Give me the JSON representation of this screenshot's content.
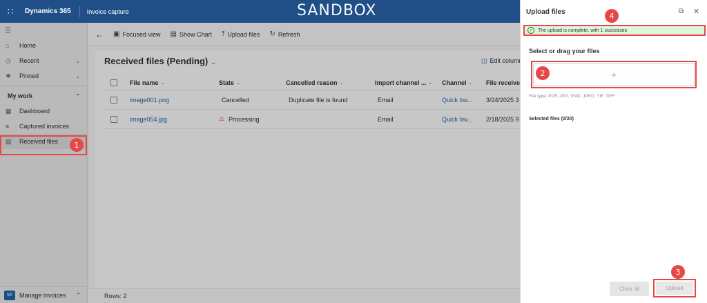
{
  "topbar": {
    "app_name": "Dynamics 365",
    "area_name": "Invoice capture",
    "environment_label": "SANDBOX"
  },
  "nav": {
    "items": [
      {
        "label": "Home",
        "icon": "home-icon"
      },
      {
        "label": "Recent",
        "icon": "clock-icon"
      },
      {
        "label": "Pinned",
        "icon": "pin-icon"
      }
    ],
    "section_title": "My work",
    "section_items": [
      {
        "label": "Dashboard",
        "icon": "dashboard-icon"
      },
      {
        "label": "Captured invoices",
        "icon": "list-icon"
      },
      {
        "label": "Received files",
        "icon": "files-icon"
      }
    ],
    "area_badge": "MI",
    "area_label": "Manage invoices"
  },
  "commandbar": {
    "focused_view": "Focused view",
    "show_chart": "Show Chart",
    "upload_files": "Upload files",
    "refresh": "Refresh"
  },
  "view": {
    "title": "Received files (Pending)",
    "edit_columns": "Edit columns",
    "rows_label": "Rows: 2"
  },
  "grid": {
    "columns": [
      "File name",
      "State",
      "Cancelled reason",
      "Import channel ...",
      "Channel",
      "File received"
    ],
    "rows": [
      {
        "file_name": "image001.png",
        "state": "Cancelled",
        "cancelled_reason": "Duplicate file is found",
        "import_channel": "Email",
        "channel": "Quick Inv...",
        "received": "3/24/2025 3"
      },
      {
        "file_name": "image054.jpg",
        "state": "Processing",
        "cancelled_reason": "",
        "import_channel": "Email",
        "channel": "Quick Inv...",
        "received": "2/18/2025 9"
      }
    ]
  },
  "panel": {
    "title": "Upload files",
    "success_message": "The upload is complete, with 1 successes",
    "select_title": "Select or drag your files",
    "dropzone_symbol": "+",
    "file_types": "File type: PDF, JPG, PNG, JPEG, TIF, TIFF",
    "selected_files": "Selected files (0/20)",
    "clear_all": "Clear all",
    "upload": "Upload"
  },
  "callouts": [
    "1",
    "2",
    "3",
    "4"
  ],
  "colors": {
    "topbar": "#1f4f86",
    "highlight": "#e64848",
    "success_bg": "#dff6dd",
    "link": "#2266a8"
  }
}
